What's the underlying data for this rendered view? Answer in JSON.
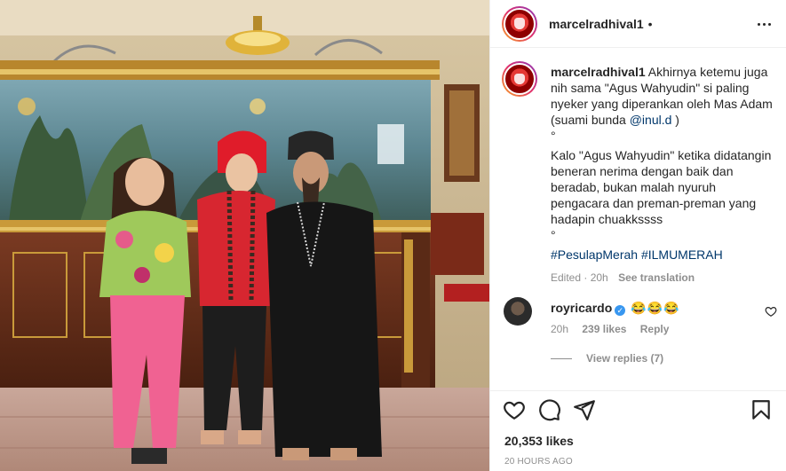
{
  "post": {
    "username": "marcelradhival1",
    "follow_dot": "•",
    "more_icon": "more-horizontal-icon",
    "caption": {
      "username": "marcelradhival1",
      "line1": "Akhirnya ketemu juga nih sama \"Agus Wahyudin\" si paling nyeker yang diperankan oleh Mas Adam (suami bunda ",
      "mention": "@inul.d",
      "line1_end": " )",
      "sep1": "°",
      "line2": "Kalo \"Agus Wahyudin\" ketika didatangin beneran nerima dengan baik dan beradab, bukan malah nyuruh pengacara dan preman-preman yang hadapin chuakkssss",
      "sep2": "°",
      "hashtags": "#PesulapMerah #ILMUMERAH",
      "edited": "Edited · 20h",
      "see_translation": "See translation"
    },
    "comment": {
      "username": "royricardo",
      "verified_icon": "verified-badge-icon",
      "text": "😂😂😂",
      "time": "20h",
      "likes": "239 likes",
      "reply": "Reply"
    },
    "view_replies": "View replies (7)",
    "actions": [
      "heart-icon",
      "comment-icon",
      "share-icon",
      "bookmark-icon"
    ],
    "likes_count": "20,353 likes",
    "timestamp": "20 HOURS AGO"
  }
}
